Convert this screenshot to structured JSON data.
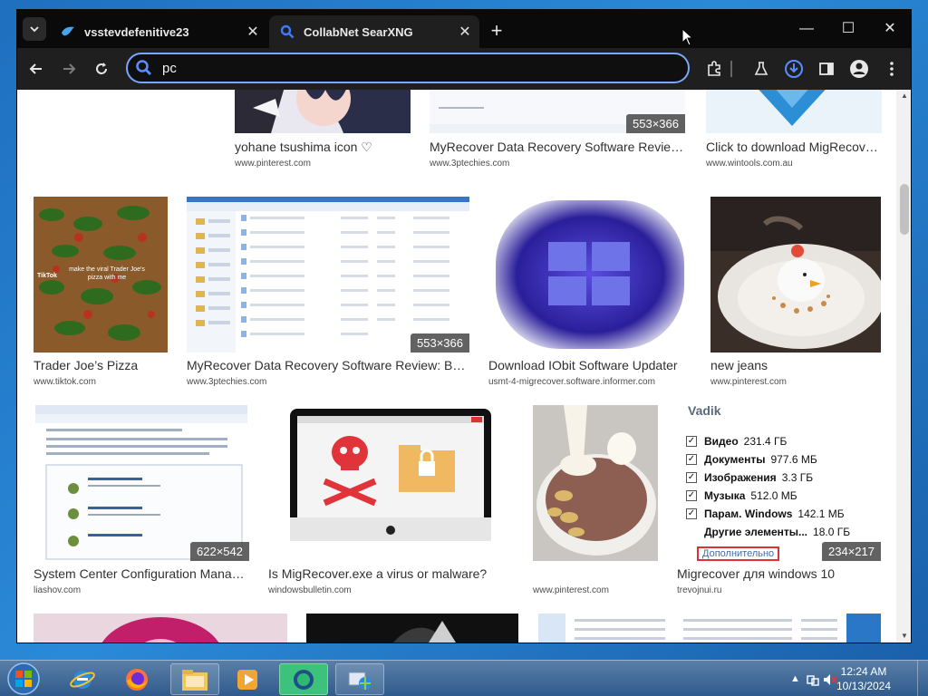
{
  "browser": {
    "tabs": [
      {
        "title": "vsstevdefenitive23",
        "active": false
      },
      {
        "title": "CollabNet SearXNG",
        "active": true
      }
    ],
    "address_bar": {
      "value": "pc",
      "placeholder": ""
    }
  },
  "results": [
    {
      "title": "yohane tsushima icon ♡",
      "source": "www.pinterest.com",
      "dimensions": ""
    },
    {
      "title": "MyRecover Data Recovery Software Review: ...",
      "source": "www.3ptechies.com",
      "dimensions": "553×366"
    },
    {
      "title": "Click to download MigRecover ...",
      "source": "www.wintools.com.au",
      "dimensions": ""
    },
    {
      "title": "Trader Joe’s Pizza",
      "source": "www.tiktok.com",
      "dimensions": ""
    },
    {
      "title": "MyRecover Data Recovery Software Review: Best ...",
      "source": "www.3ptechies.com",
      "dimensions": "553×366"
    },
    {
      "title": "Download IObit Software Updater",
      "source": "usmt-4-migrecover.software.informer.com",
      "dimensions": ""
    },
    {
      "title": "new jeans",
      "source": "www.pinterest.com",
      "dimensions": ""
    },
    {
      "title": "System Center Configuration Manager ...",
      "source": "liashov.com",
      "dimensions": "622×542"
    },
    {
      "title": "Is MigRecover.exe a virus or malware?",
      "source": "windowsbulletin.com",
      "dimensions": ""
    },
    {
      "title": "",
      "source": "www.pinterest.com",
      "dimensions": ""
    },
    {
      "title": "Migrecover для windows 10",
      "source": "trevojnui.ru",
      "dimensions": "234×217"
    }
  ],
  "thumbnail_text": {
    "tiktok": {
      "caption": "make the viral Trader Joe's pizza with me",
      "brand": "TikTok"
    },
    "vadik": {
      "header": "Vadik",
      "rows": [
        {
          "label": "Видео",
          "value": "231.4 ГБ"
        },
        {
          "label": "Документы",
          "value": "977.6 МБ"
        },
        {
          "label": "Изображения",
          "value": "3.3 ГБ"
        },
        {
          "label": "Музыка",
          "value": "512.0 МБ"
        },
        {
          "label": "Парам. Windows",
          "value": "142.1 МБ"
        },
        {
          "label": "Другие элементы...",
          "value": "18.0 ГБ"
        }
      ],
      "more": "Дополнительно"
    }
  },
  "taskbar": {
    "clock_time": "12:24 AM",
    "clock_date": "10/13/2024"
  }
}
